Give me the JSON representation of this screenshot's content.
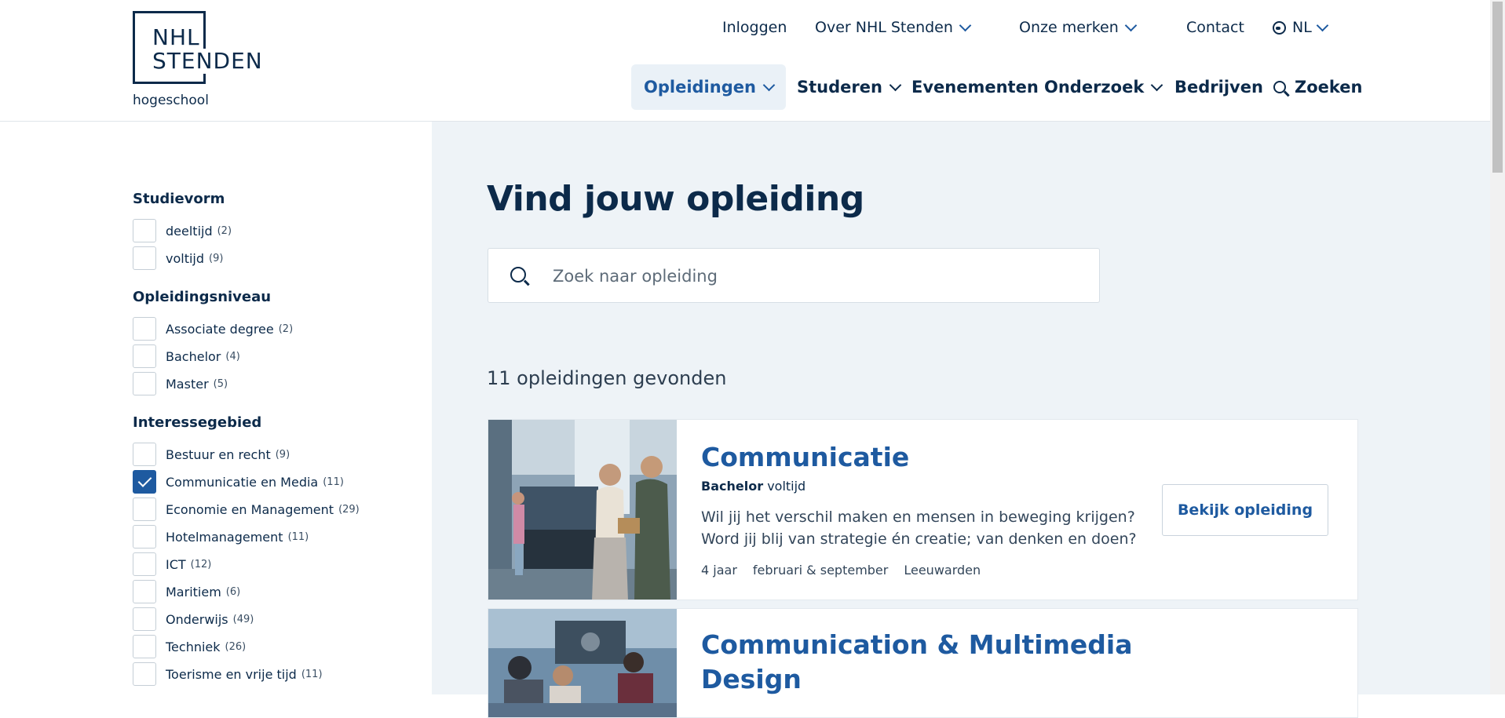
{
  "logo": {
    "line1": "NHL",
    "line2": "STENDEN",
    "sub": "hogeschool"
  },
  "topnav": {
    "login": "Inloggen",
    "about": "Over NHL Stenden",
    "brands": "Onze merken",
    "contact": "Contact",
    "language": "NL"
  },
  "mainnav": {
    "programs": "Opleidingen",
    "studying": "Studeren",
    "events": "Evenementen",
    "research": "Onderzoek",
    "companies": "Bedrijven",
    "search": "Zoeken"
  },
  "filters": {
    "studievorm": {
      "title": "Studievorm",
      "options": [
        {
          "label": "deeltijd",
          "count": "(2)",
          "checked": false
        },
        {
          "label": "voltijd",
          "count": "(9)",
          "checked": false
        }
      ]
    },
    "niveau": {
      "title": "Opleidingsniveau",
      "options": [
        {
          "label": "Associate degree",
          "count": "(2)",
          "checked": false
        },
        {
          "label": "Bachelor",
          "count": "(4)",
          "checked": false
        },
        {
          "label": "Master",
          "count": "(5)",
          "checked": false
        }
      ]
    },
    "interesse": {
      "title": "Interessegebied",
      "options": [
        {
          "label": "Bestuur en recht",
          "count": "(9)",
          "checked": false
        },
        {
          "label": "Communicatie en Media",
          "count": "(11)",
          "checked": true
        },
        {
          "label": "Economie en Management",
          "count": "(29)",
          "checked": false
        },
        {
          "label": "Hotelmanagement",
          "count": "(11)",
          "checked": false
        },
        {
          "label": "ICT",
          "count": "(12)",
          "checked": false
        },
        {
          "label": "Maritiem",
          "count": "(6)",
          "checked": false
        },
        {
          "label": "Onderwijs",
          "count": "(49)",
          "checked": false
        },
        {
          "label": "Techniek",
          "count": "(26)",
          "checked": false
        },
        {
          "label": "Toerisme en vrije tijd",
          "count": "(11)",
          "checked": false
        }
      ]
    }
  },
  "main": {
    "heading": "Vind jouw opleiding",
    "search_placeholder": "Zoek naar opleiding",
    "results_count": "11 opleidingen gevonden"
  },
  "results": [
    {
      "title": "Communicatie",
      "level": "Bachelor",
      "form": "voltijd",
      "description": "Wil jij het verschil maken en mensen in beweging krijgen? Word jij blij van strategie én creatie; van denken en doen?",
      "duration": "4 jaar",
      "start": "februari & september",
      "location": "Leeuwarden",
      "button": "Bekijk opleiding"
    },
    {
      "title": "Communication & Multimedia Design"
    }
  ],
  "colors": {
    "brand_dark": "#0c2a4a",
    "brand_blue": "#1e5aa0",
    "panel_bg": "#eef3f7"
  }
}
